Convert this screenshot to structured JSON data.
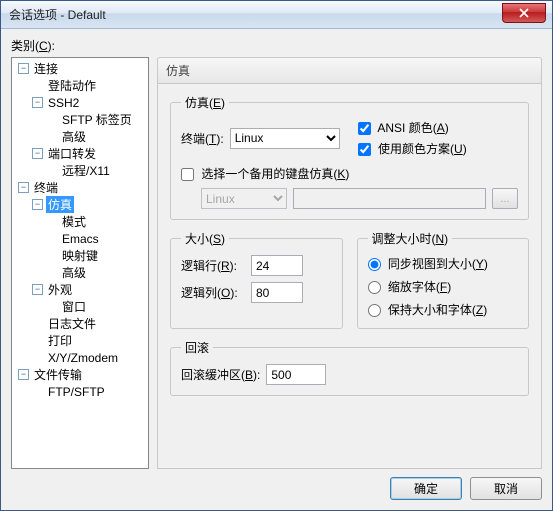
{
  "window": {
    "title": "会话选项 - Default"
  },
  "category_label": "类别(C):",
  "category_hotkey": "C",
  "tree": {
    "connection": "连接",
    "login_actions": "登陆动作",
    "ssh2": "SSH2",
    "sftp_tab": "SFTP 标签页",
    "advanced1": "高级",
    "port_forward": "端口转发",
    "remote_x11": "远程/X11",
    "terminal": "终端",
    "emulation": "仿真",
    "mode": "模式",
    "emacs": "Emacs",
    "mapped_keys": "映射键",
    "advanced2": "高级",
    "appearance": "外观",
    "window": "窗口",
    "log_file": "日志文件",
    "print": "打印",
    "xyzmodem": "X/Y/Zmodem",
    "file_transfer": "文件传输",
    "ftp_sftp": "FTP/SFTP"
  },
  "panel": {
    "title": "仿真",
    "emulation_group": "仿真(E)",
    "terminal_label": "终端(T):",
    "terminal_value": "Linux",
    "ansi_color": "ANSI 颜色(A)",
    "use_color_scheme": "使用颜色方案(U)",
    "alt_kb_check": "选择一个备用的键盘仿真(K)",
    "alt_kb_value": "Linux",
    "browse": "...",
    "size_group": "大小(S)",
    "logical_rows": "逻辑行(R):",
    "rows_value": "24",
    "logical_cols": "逻辑列(O):",
    "cols_value": "80",
    "resize_group": "调整大小时(N)",
    "sync_view": "同步视图到大小(Y)",
    "scale_font": "缩放字体(F)",
    "keep_size_font": "保持大小和字体(Z)",
    "scrollback_group": "回滚",
    "scrollback_buf": "回滚缓冲区(B):",
    "scrollback_value": "500"
  },
  "buttons": {
    "ok": "确定",
    "cancel": "取消"
  }
}
